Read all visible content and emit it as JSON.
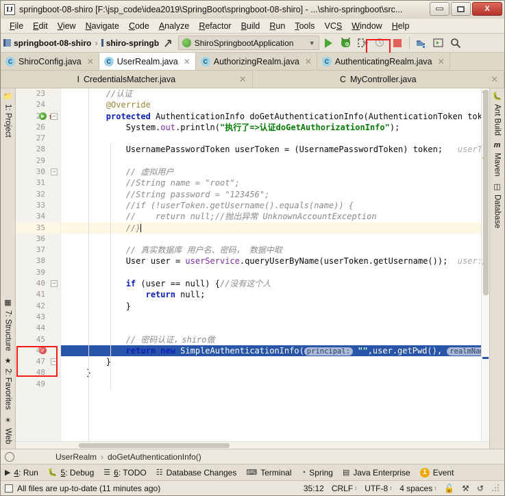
{
  "window": {
    "title": "springboot-08-shiro [F:\\jsp_code\\idea2019\\SpringBoot\\springboot-08-shiro] - ...\\shiro-springboot\\src...",
    "app_icon": "IJ",
    "minimize_label": "minimize-icon",
    "maximize_label": "maximize-icon",
    "close_label": "X"
  },
  "menubar": {
    "items": [
      {
        "head": "F",
        "rest": "ile"
      },
      {
        "head": "E",
        "rest": "dit"
      },
      {
        "head": "V",
        "rest": "iew"
      },
      {
        "head": "N",
        "rest": "avigate"
      },
      {
        "head": "C",
        "rest": "ode"
      },
      {
        "head": "A",
        "rest": "nalyze"
      },
      {
        "head": "R",
        "rest": "efactor"
      },
      {
        "head": "B",
        "rest": "uild"
      },
      {
        "head": "R",
        "rest": "un"
      },
      {
        "head": "T",
        "rest": "ools"
      },
      {
        "head": "VCS",
        "rest": ""
      },
      {
        "head": "W",
        "rest": "indow"
      },
      {
        "head": "H",
        "rest": "elp"
      }
    ]
  },
  "toolbar": {
    "crumb1": "springboot-08-shiro",
    "crumb_sep": "›",
    "crumb2": "shiro-springboot",
    "run_config": "ShiroSpringbootApplication",
    "chevron": "⌄",
    "buttons": [
      {
        "name": "run-button",
        "glyph": "▶"
      },
      {
        "name": "debug-button",
        "glyph": "bug"
      },
      {
        "name": "run-with-coverage-button",
        "glyph": "⎘"
      },
      {
        "name": "profile-button",
        "glyph": "◴"
      },
      {
        "name": "stop-button",
        "glyph": "■"
      },
      {
        "name": "update-project-button",
        "glyph": "⎘"
      },
      {
        "name": "open-in-browser-button",
        "glyph": "▣"
      },
      {
        "name": "search-everywhere-button",
        "glyph": "⌕"
      }
    ]
  },
  "editor_tabs": {
    "row1": [
      {
        "label": "ShiroConfig.java",
        "kind": "C",
        "active": false
      },
      {
        "label": "UserRealm.java",
        "kind": "C",
        "active": true,
        "highlighted": true
      },
      {
        "label": "AuthorizingRealm.java",
        "kind": "C",
        "active": false
      },
      {
        "label": "AuthenticatingRealm.java",
        "kind": "C",
        "active": false
      }
    ],
    "row2": [
      {
        "label": "CredentialsMatcher.java",
        "kind": "I",
        "active": false
      },
      {
        "label": "MyController.java",
        "kind": "C",
        "active": false
      }
    ],
    "close_glyph": "✕"
  },
  "left_strip": {
    "items": [
      {
        "label": "1: Project",
        "icon": "folder-icon"
      },
      {
        "label": "7: Structure",
        "icon": "structure-icon"
      },
      {
        "label": "2: Favorites",
        "icon": "star-icon"
      },
      {
        "label": "Web",
        "icon": "globe-icon"
      }
    ]
  },
  "right_strip": {
    "items": [
      {
        "label": "Ant Build",
        "icon": "ant-icon"
      },
      {
        "label": "Maven",
        "icon": "maven-icon"
      },
      {
        "label": "Database",
        "icon": "database-icon"
      }
    ]
  },
  "editor": {
    "first_line_number": 23,
    "lines": [
      {
        "n": 23,
        "indent": 2,
        "tokens": [
          {
            "t": "comment",
            "v": "//认证"
          }
        ]
      },
      {
        "n": 24,
        "indent": 2,
        "tokens": [
          {
            "t": "annotation",
            "v": "@Override"
          }
        ]
      },
      {
        "n": 25,
        "indent": 2,
        "gutter": "run-method-marker",
        "fold": true,
        "tokens": [
          {
            "t": "kw",
            "v": "protected"
          },
          {
            "t": "plain",
            "v": " AuthenticationInfo doGetAuthenticationInfo(AuthenticationToken token) thro"
          }
        ]
      },
      {
        "n": 26,
        "indent": 3,
        "tokens": [
          {
            "t": "plain",
            "v": "System."
          },
          {
            "t": "field",
            "v": "out"
          },
          {
            "t": "plain",
            "v": ".println("
          },
          {
            "t": "string",
            "v": "\"执行了=>认证doGetAuthorizationInfo\""
          },
          {
            "t": "plain",
            "v": ");"
          }
        ]
      },
      {
        "n": 27,
        "indent": 0,
        "tokens": []
      },
      {
        "n": 28,
        "indent": 3,
        "tokens": [
          {
            "t": "plain",
            "v": "UsernamePasswordToken userToken = (UsernamePasswordToken) token;"
          },
          {
            "t": "hint",
            "v": "   userToken: \"or"
          }
        ]
      },
      {
        "n": 29,
        "indent": 0,
        "tokens": []
      },
      {
        "n": 30,
        "indent": 3,
        "fold": true,
        "tokens": [
          {
            "t": "comment",
            "v": "// 虚拟用户"
          }
        ]
      },
      {
        "n": 31,
        "indent": 3,
        "tokens": [
          {
            "t": "comment",
            "v": "//String name = \"root\";"
          }
        ]
      },
      {
        "n": 32,
        "indent": 3,
        "tokens": [
          {
            "t": "comment",
            "v": "//String password = \"123456\";"
          }
        ]
      },
      {
        "n": 33,
        "indent": 3,
        "tokens": [
          {
            "t": "comment",
            "v": "//if (!userToken.getUsername().equals(name)) {"
          }
        ]
      },
      {
        "n": 34,
        "indent": 3,
        "tokens": [
          {
            "t": "comment",
            "v": "//    return null;//抛出异常 UnknownAccountException"
          }
        ]
      },
      {
        "n": 35,
        "indent": 3,
        "highlight": true,
        "caret": true,
        "tokens": [
          {
            "t": "comment",
            "v": "//}"
          }
        ]
      },
      {
        "n": 36,
        "indent": 0,
        "tokens": []
      },
      {
        "n": 37,
        "indent": 3,
        "tokens": [
          {
            "t": "comment",
            "v": "// 真实数据库 用户名、密码， 数据中取"
          }
        ]
      },
      {
        "n": 38,
        "indent": 3,
        "tokens": [
          {
            "t": "plain",
            "v": "User user = "
          },
          {
            "t": "field",
            "v": "userService"
          },
          {
            "t": "plain",
            "v": ".queryUserByName(userToken.getUsername());"
          },
          {
            "t": "hint",
            "v": "  user: \"User(i"
          }
        ]
      },
      {
        "n": 39,
        "indent": 0,
        "tokens": []
      },
      {
        "n": 40,
        "indent": 3,
        "fold": true,
        "tokens": [
          {
            "t": "kw",
            "v": "if"
          },
          {
            "t": "plain",
            "v": " (user == null) {"
          },
          {
            "t": "comment",
            "v": "//没有这个人"
          }
        ]
      },
      {
        "n": 41,
        "indent": 4,
        "tokens": [
          {
            "t": "kw",
            "v": "return"
          },
          {
            "t": "plain",
            "v": " null;"
          }
        ]
      },
      {
        "n": 42,
        "indent": 3,
        "tokens": [
          {
            "t": "plain",
            "v": "}"
          }
        ]
      },
      {
        "n": 43,
        "indent": 0,
        "tokens": []
      },
      {
        "n": 44,
        "indent": 0,
        "tokens": []
      },
      {
        "n": 45,
        "indent": 3,
        "tokens": [
          {
            "t": "comment",
            "v": "// 密码认证，shiro做"
          }
        ]
      },
      {
        "n": 46,
        "indent": 3,
        "selected": true,
        "gutter": "breakpoint-marker",
        "tokens": [
          {
            "t": "kw",
            "v": "return new"
          },
          {
            "t": "plain",
            "v": " SimpleAuthenticationInfo("
          },
          {
            "t": "chip",
            "v": "principal:"
          },
          {
            "t": "string",
            "v": " \"\""
          },
          {
            "t": "plain",
            "v": ",user.getPwd(), "
          },
          {
            "t": "chip",
            "v": "realmName:"
          },
          {
            "t": "string",
            "v": " \"\""
          },
          {
            "t": "plain",
            "v": ");"
          },
          {
            "t": "hint",
            "v": "  u"
          }
        ]
      },
      {
        "n": 47,
        "indent": 2,
        "fold": true,
        "tokens": [
          {
            "t": "plain",
            "v": "}"
          }
        ]
      },
      {
        "n": 48,
        "indent": 1,
        "tokens": [
          {
            "t": "plain",
            "v": "}"
          }
        ]
      },
      {
        "n": 49,
        "indent": 0,
        "tokens": []
      }
    ]
  },
  "breadcrumb": {
    "class": "UserRealm",
    "sep": "›",
    "method": "doGetAuthenticationInfo()"
  },
  "tool_windows": [
    {
      "label_head": "4",
      "label_rest": ": Run",
      "icon": "run-icon"
    },
    {
      "label_head": "5",
      "label_rest": ": Debug",
      "icon": "debug-icon"
    },
    {
      "label_head": "6",
      "label_rest": ": TODO",
      "icon": "todo-icon"
    },
    {
      "label_head": "",
      "label_rest": "Database Changes",
      "icon": "database-changes-icon"
    },
    {
      "label_head": "",
      "label_rest": "Terminal",
      "icon": "terminal-icon"
    },
    {
      "label_head": "",
      "label_rest": "Spring",
      "icon": "spring-icon"
    },
    {
      "label_head": "",
      "label_rest": "Java Enterprise",
      "icon": "java-enterprise-icon"
    },
    {
      "label_head": "",
      "label_rest": "Event",
      "icon": "event-log-icon",
      "badge": "1"
    }
  ],
  "statusbar": {
    "message": "All files are up-to-date (11 minutes ago)",
    "caret_position": "35:12",
    "line_separator": "CRLF",
    "encoding": "UTF-8",
    "indent": "4 spaces",
    "lock_icon": "unlocked-icon",
    "inspection_icon": "inspection-icon",
    "help_icon": "help-icon",
    "arrows": "↕"
  },
  "highlights": {
    "color": "#f21a1a",
    "boxes": [
      "debug-button",
      "userrealm-tab",
      "line-46-gutter"
    ]
  }
}
